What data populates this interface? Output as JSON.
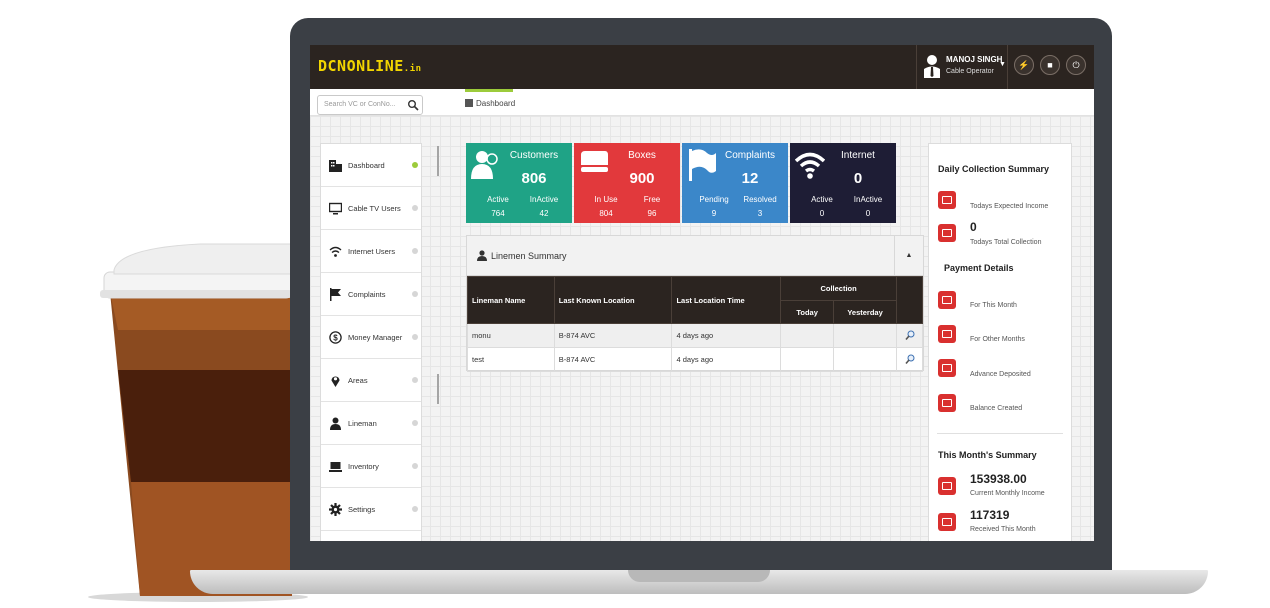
{
  "header": {
    "logo_main": "DCNONLINE",
    "logo_suffix": ".in",
    "user_name": "MANOJ SINGH",
    "user_role": "Cable Operator"
  },
  "subbar": {
    "search_placeholder": "Search VC or ConNo...",
    "breadcrumb": "Dashboard"
  },
  "sidebar": {
    "items": [
      {
        "label": "Dashboard",
        "icon": "building-icon",
        "active": true
      },
      {
        "label": "Cable TV Users",
        "icon": "monitor-icon",
        "active": false
      },
      {
        "label": "Internet Users",
        "icon": "wifi-icon",
        "active": false
      },
      {
        "label": "Complaints",
        "icon": "flag-icon",
        "active": false
      },
      {
        "label": "Money Manager",
        "icon": "dollar-icon",
        "active": false
      },
      {
        "label": "Areas",
        "icon": "map-pin-icon",
        "active": false
      },
      {
        "label": "Lineman",
        "icon": "user-icon",
        "active": false
      },
      {
        "label": "Inventory",
        "icon": "laptop-icon",
        "active": false
      },
      {
        "label": "Settings",
        "icon": "gear-icon",
        "active": false
      }
    ]
  },
  "tiles": [
    {
      "title": "Customers",
      "value": "806",
      "l1": "Active",
      "r1": "InActive",
      "l2": "764",
      "r2": "42",
      "color": "#1fa386",
      "icon": "users-icon"
    },
    {
      "title": "Boxes",
      "value": "900",
      "l1": "In Use",
      "r1": "Free",
      "l2": "804",
      "r2": "96",
      "color": "#e2393c",
      "icon": "box-icon"
    },
    {
      "title": "Complaints",
      "value": "12",
      "l1": "Pending",
      "r1": "Resolved",
      "l2": "9",
      "r2": "3",
      "color": "#3b87c9",
      "icon": "flag-icon"
    },
    {
      "title": "Internet",
      "value": "0",
      "l1": "Active",
      "r1": "InActive",
      "l2": "0",
      "r2": "0",
      "color": "#1e1d35",
      "icon": "wifi-icon"
    }
  ],
  "linemen": {
    "title": "Linemen Summary",
    "headers": {
      "name": "Lineman Name",
      "location": "Last Known Location",
      "time": "Last Location Time",
      "collection": "Collection",
      "today": "Today",
      "yesterday": "Yesterday"
    },
    "rows": [
      {
        "name": "monu",
        "location": "B-874 AVC",
        "time": "4 days ago",
        "today": "",
        "yesterday": ""
      },
      {
        "name": "test",
        "location": "B-874 AVC",
        "time": "4 days ago",
        "today": "",
        "yesterday": ""
      }
    ]
  },
  "daily": {
    "title": "Daily Collection Summary",
    "expected_label": "Todays Expected Income",
    "collection_value": "0",
    "collection_label": "Todays Total Collection"
  },
  "payment": {
    "title": "Payment Details",
    "items": [
      "For This Month",
      "For Other Months",
      "Advance Deposited",
      "Balance Created"
    ]
  },
  "month": {
    "title": "This Month's Summary",
    "income_value": "153938.00",
    "income_label": "Current Monthly Income",
    "received_value": "117319",
    "received_label": "Received This Month"
  }
}
